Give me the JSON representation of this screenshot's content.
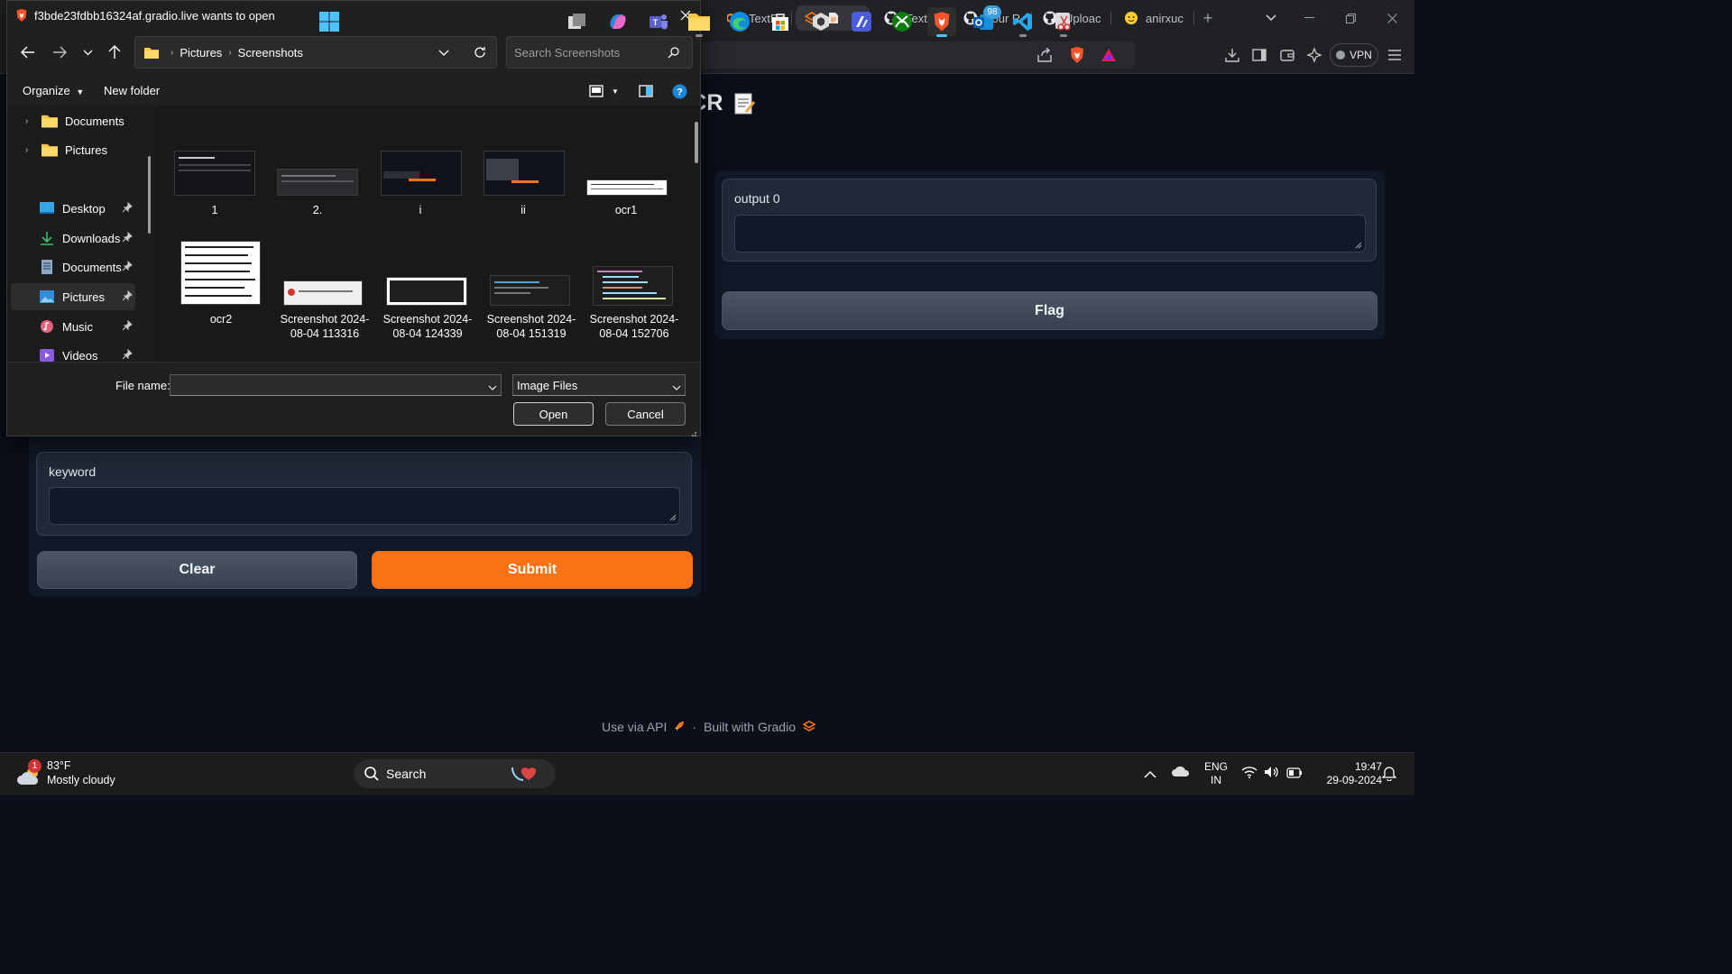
{
  "browser": {
    "tabs": [
      {
        "label": "TextFin",
        "icon": "infinity-icon",
        "active": false
      },
      {
        "label": "",
        "icon": "gradio-icon",
        "active": true
      },
      {
        "label": "TextFin",
        "icon": "github-icon",
        "active": false
      },
      {
        "label": "Your R",
        "icon": "github-icon",
        "active": false
      },
      {
        "label": "Uploac",
        "icon": "github-icon",
        "active": false
      },
      {
        "label": "anirxuc",
        "icon": "huggingface-icon",
        "active": false
      }
    ],
    "vpn_label": "VPN",
    "colors": {
      "accent_orange": "#f97316",
      "brave_orange": "#fb542b"
    }
  },
  "gradio": {
    "title_visible": "der OCR",
    "output_label": "output 0",
    "output_value": "",
    "flag_label": "Flag",
    "keyword_label": "keyword",
    "keyword_value": "",
    "clear_label": "Clear",
    "submit_label": "Submit",
    "footer": {
      "api_label": "Use via API",
      "separator": "·",
      "built_label": "Built with Gradio"
    }
  },
  "dialog": {
    "title": "f3bde23fdbb16324af.gradio.live wants to open",
    "breadcrumb": [
      "Pictures",
      "Screenshots"
    ],
    "search_placeholder": "Search Screenshots",
    "organize_label": "Organize",
    "new_folder_label": "New folder",
    "nav_items": [
      {
        "label": "Documents",
        "icon": "folder-icon",
        "expandable": true,
        "pinned": false
      },
      {
        "label": "Pictures",
        "icon": "folder-icon",
        "expandable": true,
        "pinned": false
      },
      {
        "label": "Desktop",
        "icon": "desktop-icon",
        "expandable": false,
        "pinned": true
      },
      {
        "label": "Downloads",
        "icon": "download-icon",
        "expandable": false,
        "pinned": true
      },
      {
        "label": "Documents",
        "icon": "documents-icon",
        "expandable": false,
        "pinned": true
      },
      {
        "label": "Pictures",
        "icon": "pictures-icon",
        "expandable": false,
        "pinned": true,
        "selected": true
      },
      {
        "label": "Music",
        "icon": "music-icon",
        "expandable": false,
        "pinned": true
      },
      {
        "label": "Videos",
        "icon": "videos-icon",
        "expandable": false,
        "pinned": true
      }
    ],
    "files": [
      {
        "name": "1"
      },
      {
        "name": "2."
      },
      {
        "name": "i"
      },
      {
        "name": "ii"
      },
      {
        "name": "ocr1"
      },
      {
        "name": "ocr2"
      },
      {
        "name": "Screenshot 2024-08-04 113316"
      },
      {
        "name": "Screenshot 2024-08-04 124339"
      },
      {
        "name": "Screenshot 2024-08-04 151319"
      },
      {
        "name": "Screenshot 2024-08-04 152706"
      }
    ],
    "file_name_label": "File name:",
    "file_name_value": "",
    "file_type": "Image Files",
    "open_label": "Open",
    "cancel_label": "Cancel"
  },
  "taskbar": {
    "weather": {
      "badge": "1",
      "temp": "83°F",
      "condition": "Mostly cloudy"
    },
    "search_label": "Search",
    "outlook_badge": "98",
    "language": [
      "ENG",
      "IN"
    ],
    "time": "19:47",
    "date": "29-09-2024"
  }
}
